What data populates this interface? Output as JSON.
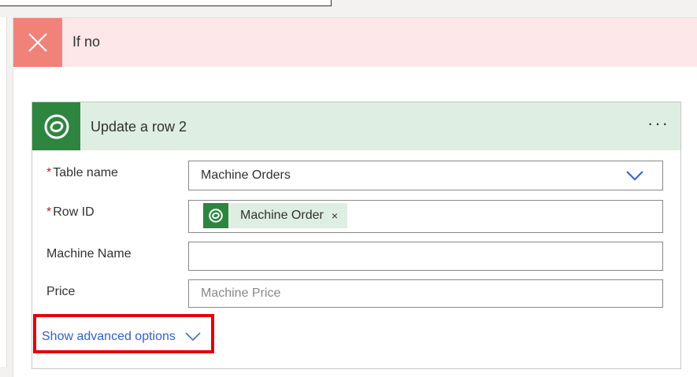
{
  "branch": {
    "title": "If no",
    "icon": "close-icon",
    "header_bg": "#fde7e9",
    "icon_bg": "#f1827a"
  },
  "action": {
    "title": "Update a row 2",
    "icon": "dataverse-icon",
    "menu_label": "···",
    "accent": "#2e8540",
    "header_bg": "#dfeee2"
  },
  "fields": {
    "table_name": {
      "required_mark": "*",
      "label": "Table name",
      "value": "Machine Orders",
      "icon": "chevron-down-icon"
    },
    "row_id": {
      "required_mark": "*",
      "label": "Row ID",
      "token_label": "Machine Order",
      "token_close": "×",
      "token_icon": "dataverse-icon"
    },
    "machine_name": {
      "label": "Machine Name",
      "value": ""
    },
    "price": {
      "label": "Price",
      "placeholder": "Machine Price"
    }
  },
  "advanced": {
    "label": "Show advanced options",
    "icon": "chevron-down-icon",
    "highlight_color": "#e3000b",
    "link_color": "#2f5fd0"
  }
}
